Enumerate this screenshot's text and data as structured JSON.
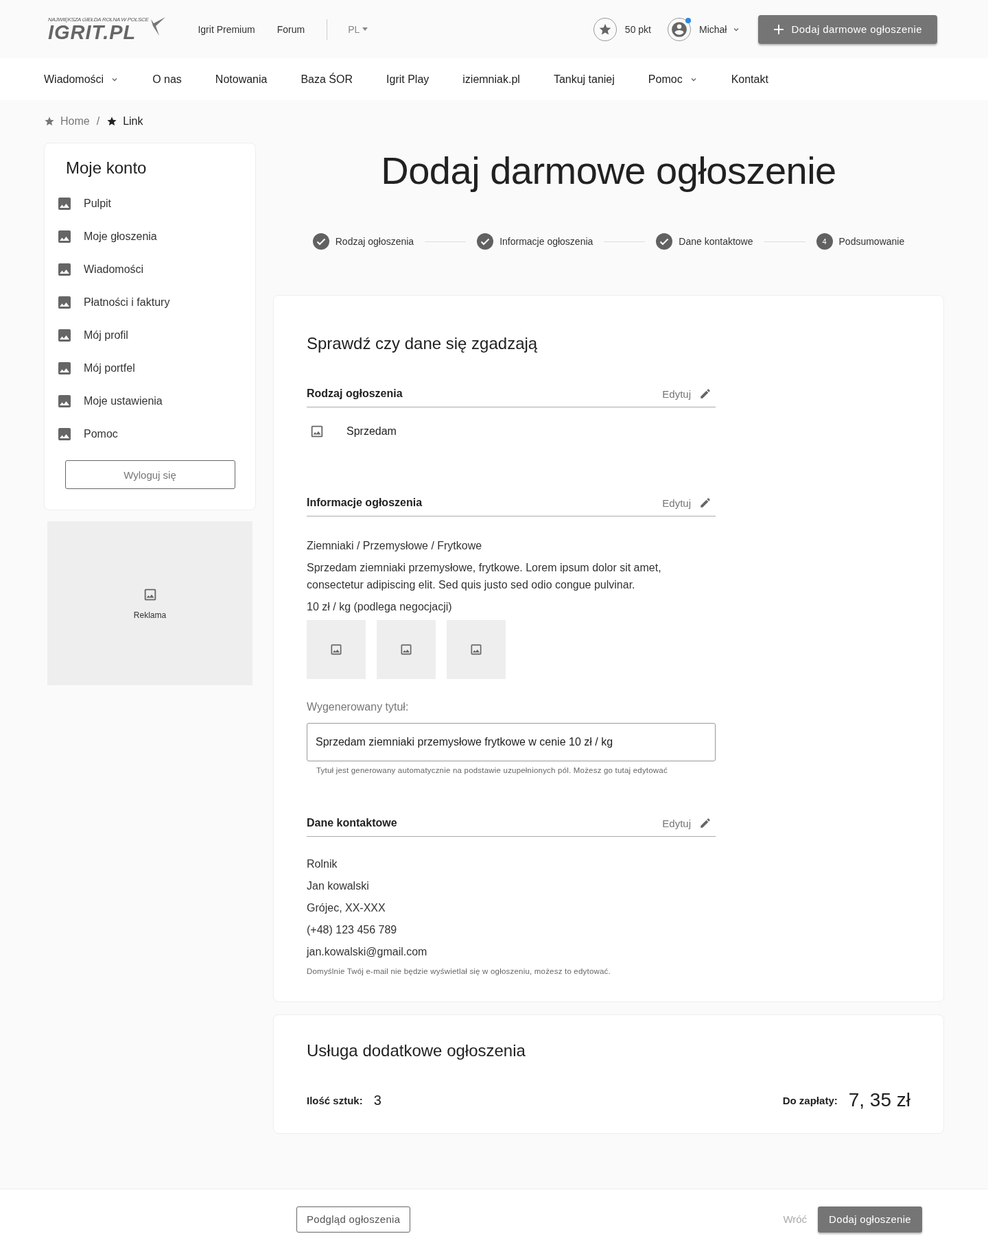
{
  "header": {
    "logo": {
      "tagline": "NAJWIĘKSZA GIEŁDA ROLNA W POLSCE",
      "name": "IGRIT.PL"
    },
    "links": [
      "Igrit Premium",
      "Forum"
    ],
    "language": "PL",
    "points": "50 pkt",
    "user": {
      "name": "Michał",
      "notification": true
    },
    "cta": "Dodaj darmowe ogłoszenie"
  },
  "nav": [
    {
      "label": "Wiadomości",
      "dropdown": true
    },
    {
      "label": "O nas",
      "dropdown": false
    },
    {
      "label": "Notowania",
      "dropdown": false
    },
    {
      "label": "Baza ŚOR",
      "dropdown": false
    },
    {
      "label": "Igrit Play",
      "dropdown": false
    },
    {
      "label": "iziemniak.pl",
      "dropdown": false
    },
    {
      "label": "Tankuj taniej",
      "dropdown": false
    },
    {
      "label": "Pomoc",
      "dropdown": true
    },
    {
      "label": "Kontakt",
      "dropdown": false
    }
  ],
  "breadcrumb": [
    {
      "label": "Home",
      "selected": false
    },
    {
      "separator": "/",
      "label": "Link",
      "selected": true
    }
  ],
  "sidebar": {
    "title": "Moje konto",
    "items": [
      "Pulpit",
      "Moje głoszenia",
      "Wiadomości",
      "Płatności i faktury",
      "Mój profil",
      "Mój portfel",
      "Moje ustawienia",
      "Pomoc"
    ],
    "logout": "Wyloguj się",
    "ad": "Reklama"
  },
  "page_title": "Dodaj darmowe ogłoszenie",
  "steps": [
    {
      "label": "Rodzaj ogłoszenia",
      "done": true
    },
    {
      "label": "Informacje ogłoszenia",
      "done": true
    },
    {
      "label": "Dane kontaktowe",
      "done": true
    },
    {
      "label": "Podsumowanie",
      "done": false,
      "number": "4"
    }
  ],
  "summary": {
    "title": "Sprawdź czy dane się zgadzają",
    "sections": [
      {
        "kind": "type",
        "title": "Rodzaj ogłoszenia",
        "edit": "Edytuj",
        "value": "Sprzedam"
      },
      {
        "kind": "info",
        "title": "Informacje ogłoszenia",
        "edit": "Edytuj",
        "category": "Ziemniaki / Przemysłowe / Frytkowe",
        "description": "Sprzedam ziemniaki przemysłowe, frytkowe. Lorem ipsum dolor sit amet, consectetur adipiscing elit. Sed quis justo sed odio congue pulvinar.",
        "price": "10 zł / kg (podlega negocjacji)",
        "photos": [
          {
            "kind": "placeholder"
          },
          {
            "kind": "placeholder"
          },
          {
            "kind": "placeholder"
          }
        ],
        "generated_title": {
          "label": "Wygenerowany tytuł:",
          "value": "Sprzedam ziemniaki przemysłowe frytkowe w cenie 10 zł / kg",
          "hint": "Tytuł jest generowany automatycznie na podstawie uzupełnionych pól. Możesz go tutaj edytować"
        }
      },
      {
        "kind": "contact",
        "title": "Dane kontaktowe",
        "edit": "Edytuj",
        "lines": [
          "Rolnik",
          "Jan kowalski",
          "Grójec, XX-XXX",
          "(+48) 123 456 789",
          "jan.kowalski@gmail.com"
        ],
        "note": "Domyślnie Twój e-mail nie będzie wyświetlał się w ogłoszeniu, możesz to edytować."
      }
    ]
  },
  "extra_service": {
    "title": "Usługa dodatkowe ogłoszenia",
    "quantity_label": "Ilość sztuk:",
    "quantity": "3",
    "total_label": "Do zapłaty:",
    "total": "7, 35 zł"
  },
  "footer": {
    "preview": "Podgląd ogłoszenia",
    "back": "Wróć",
    "submit": "Dodaj ogłoszenie"
  }
}
